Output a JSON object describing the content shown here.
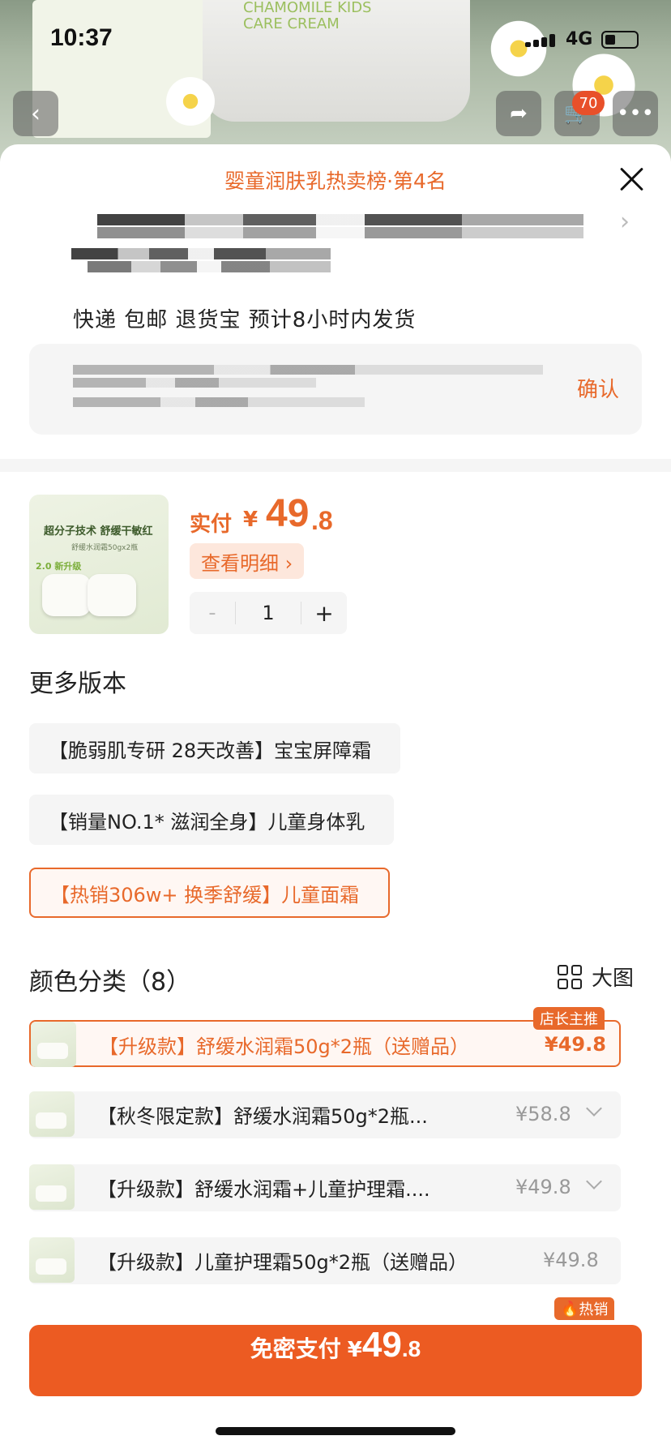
{
  "status_bar": {
    "time": "10:37",
    "network": "4G"
  },
  "nav": {
    "cart_count": "70"
  },
  "banner": {
    "product_label": "CHAMOMILE KIDS CARE CREAM"
  },
  "sheet": {
    "rank_text": "婴童润肤乳热卖榜·第4名",
    "delivery": "快递 包邮 退货宝 预计8小时内发货",
    "confirm": "确认"
  },
  "product": {
    "thumb_line1": "超分子技术 舒缓干敏红",
    "thumb_line2": "舒缓水润霜50gx2瓶",
    "thumb_tag": "2.0 新升级",
    "pay_label": "实付",
    "currency": "¥",
    "price_int": "49",
    "price_dec": ".8",
    "detail_button": "查看明细 ›",
    "quantity": "1",
    "minus": "-",
    "plus": "+"
  },
  "versions": {
    "title": "更多版本",
    "items": [
      {
        "label": "【脆弱肌专研 28天改善】宝宝屏障霜",
        "selected": false
      },
      {
        "label": "【销量NO.1* 滋润全身】儿童身体乳",
        "selected": false
      },
      {
        "label": "【热销306w+ 换季舒缓】儿童面霜",
        "selected": true
      }
    ]
  },
  "colors": {
    "title": "颜色分类（8）",
    "big_view": "大图",
    "items": [
      {
        "label": "【升级款】舒缓水润霜50g*2瓶（送赠品）",
        "price": "¥49.8",
        "badge": "店长主推",
        "selected": true
      },
      {
        "label": "【秋冬限定款】舒缓水润霜50g*2瓶...",
        "price": "¥58.8",
        "badge": "",
        "selected": false
      },
      {
        "label": "【升级款】舒缓水润霜+儿童护理霜....",
        "price": "¥49.8",
        "badge": "",
        "selected": false
      },
      {
        "label": "【升级款】儿童护理霜50g*2瓶（送赠品）",
        "price": "¥49.8",
        "badge": "",
        "selected": false
      }
    ],
    "next_badge": "热销"
  },
  "footer": {
    "pay_text": "免密支付",
    "currency": "¥",
    "price_int": "49",
    "price_dec": ".8"
  },
  "colors_theme": {
    "accent": "#e8692b",
    "button": "#ec5b22"
  }
}
